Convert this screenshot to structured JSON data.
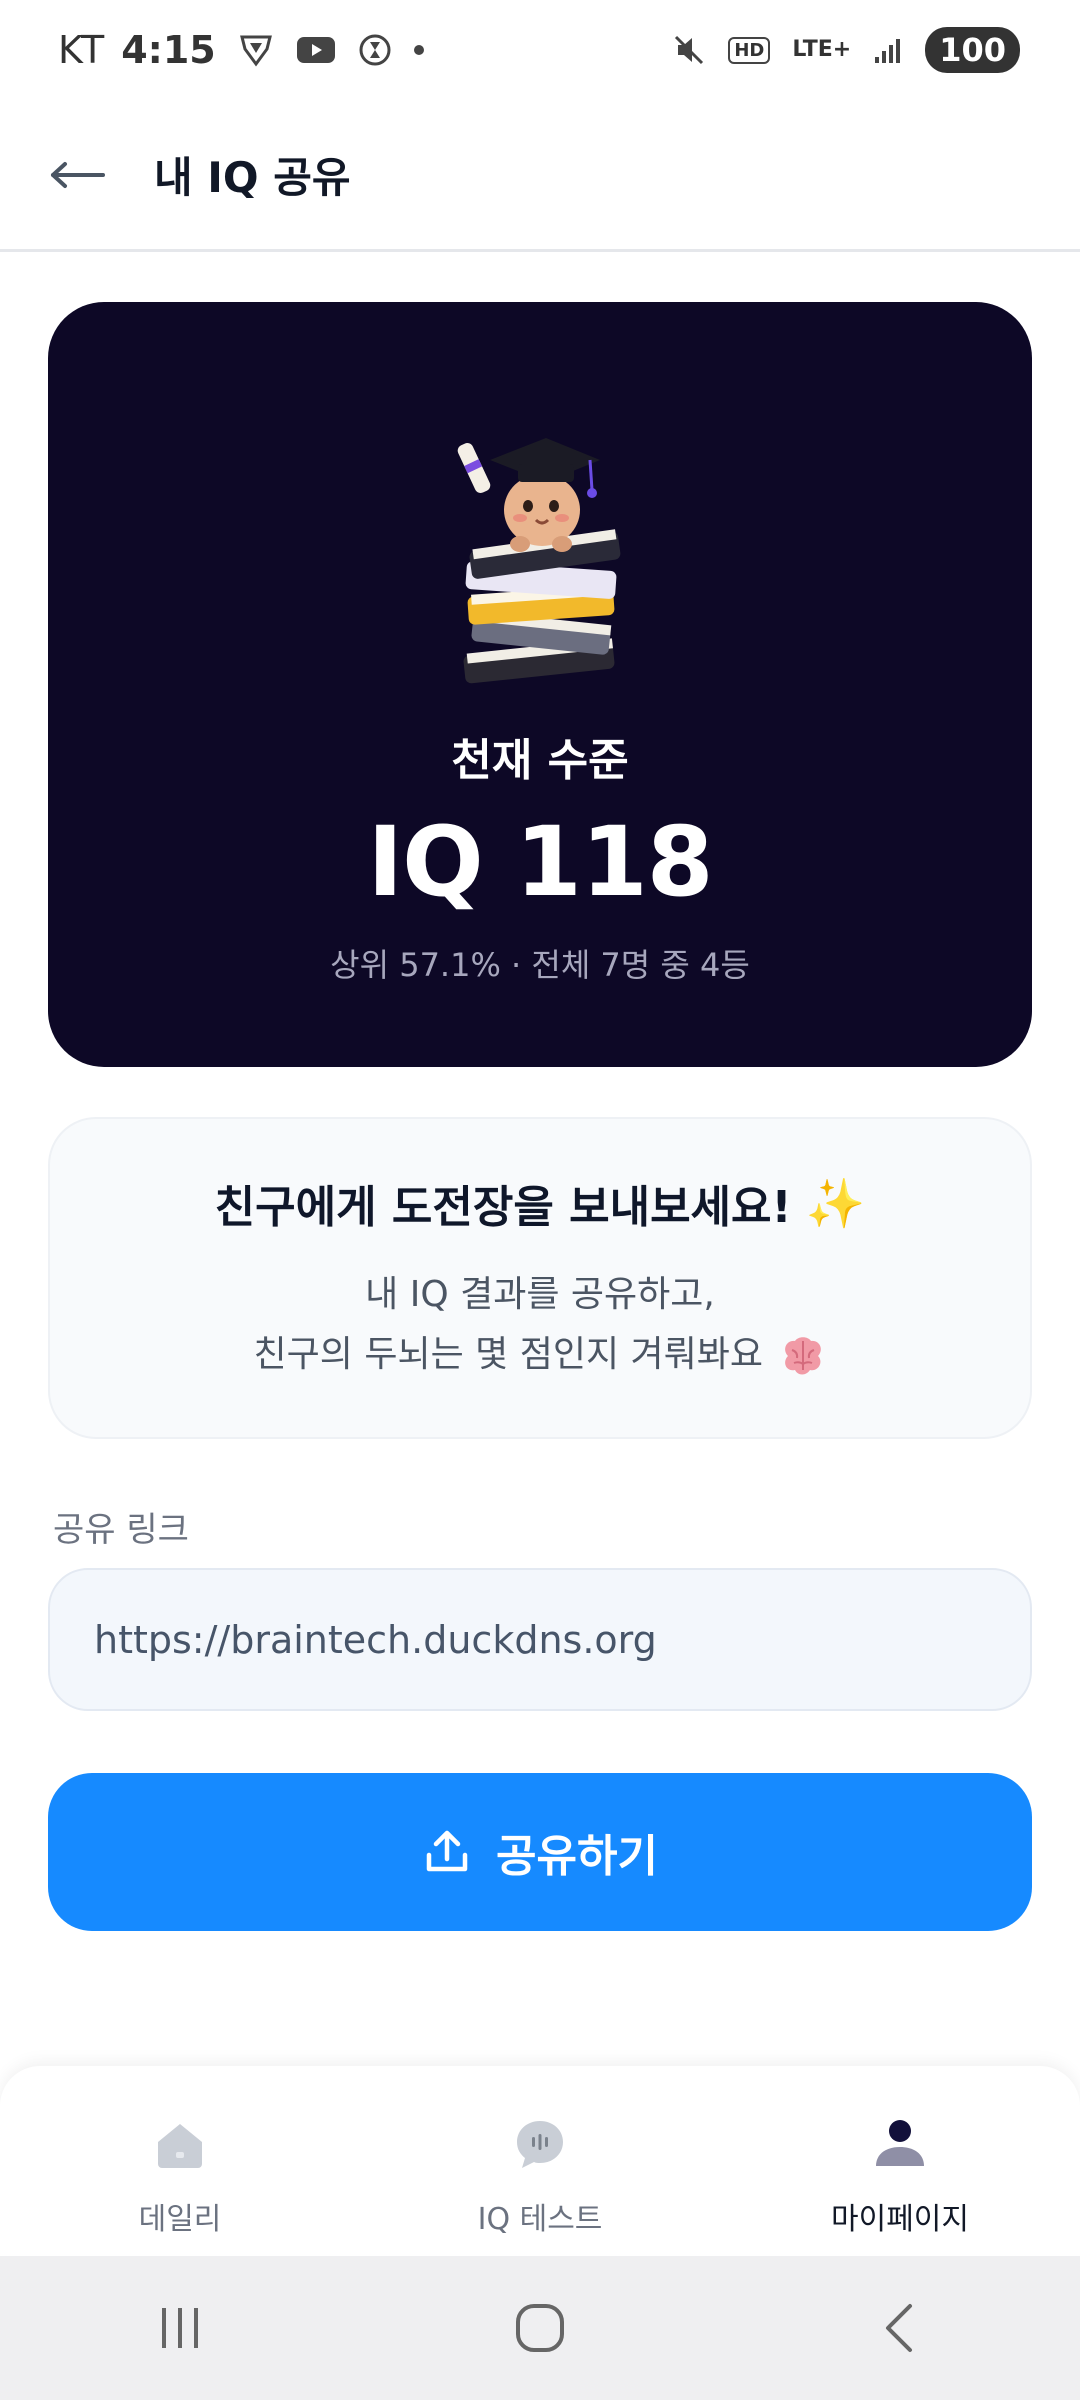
{
  "status_bar": {
    "carrier": "KT",
    "time": "4:15",
    "network": "LTE+",
    "hd": "HD",
    "battery": "100"
  },
  "header": {
    "title": "내 IQ 공유",
    "back_icon": "arrow-left-icon"
  },
  "result_card": {
    "level": "천재 수준",
    "iq": "IQ 118",
    "rank": "상위 57.1% · 전체 7명 중 4등"
  },
  "challenge": {
    "title": "친구에게 도전장을 보내보세요!",
    "line1": "내 IQ 결과를 공유하고,",
    "line2": "친구의 두뇌는 몇 점인지 겨뤄봐요"
  },
  "share": {
    "label": "공유 링크",
    "url": "https://braintech.duckdns.org",
    "button_label": "공유하기"
  },
  "bottom_nav": {
    "items": [
      {
        "label": "데일리",
        "icon": "home-icon"
      },
      {
        "label": "IQ 테스트",
        "icon": "chat-icon"
      },
      {
        "label": "마이페이지",
        "icon": "user-icon"
      }
    ],
    "active_index": 2
  },
  "colors": {
    "primary": "#168aff",
    "card_dark": "#0d0826",
    "sparkle": "#f5b21b"
  }
}
